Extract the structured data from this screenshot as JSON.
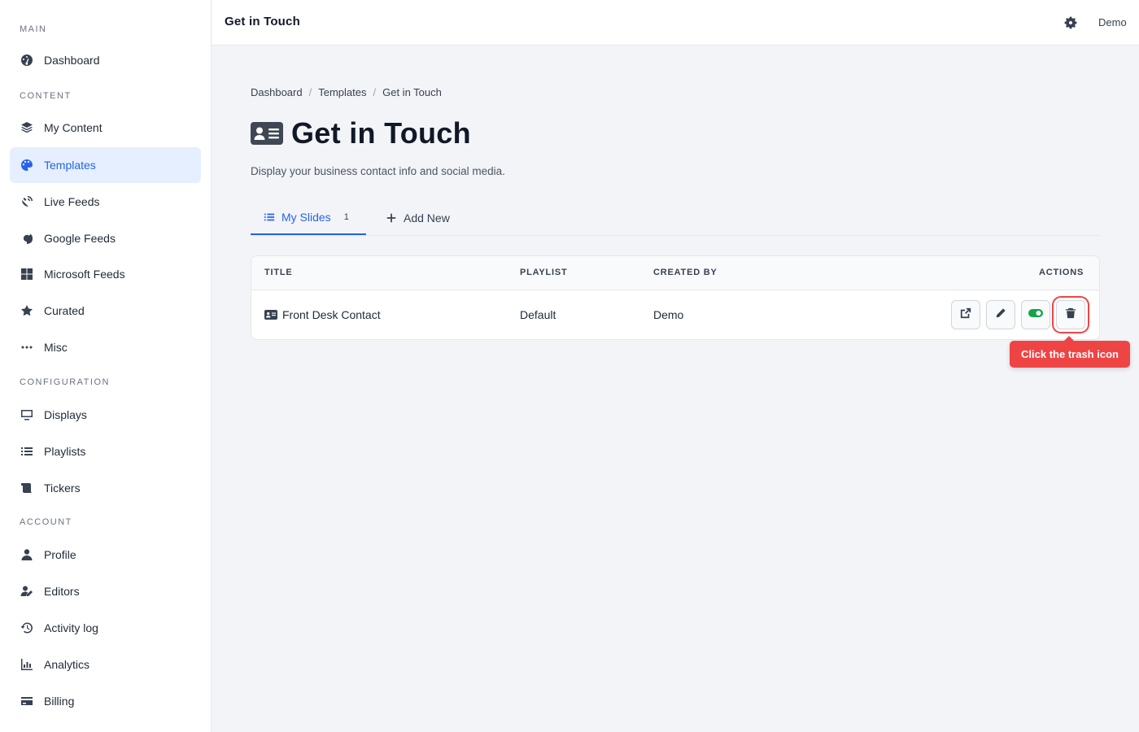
{
  "sidebar": {
    "sections": {
      "main": "MAIN",
      "content": "CONTENT",
      "configuration": "CONFIGURATION",
      "account": "ACCOUNT"
    },
    "items": {
      "dashboard": "Dashboard",
      "my_content": "My Content",
      "templates": "Templates",
      "live_feeds": "Live Feeds",
      "google_feeds": "Google Feeds",
      "microsoft_feeds": "Microsoft Feeds",
      "curated": "Curated",
      "misc": "Misc",
      "displays": "Displays",
      "playlists": "Playlists",
      "tickers": "Tickers",
      "profile": "Profile",
      "editors": "Editors",
      "activity_log": "Activity log",
      "analytics": "Analytics",
      "billing": "Billing"
    },
    "active_item": "templates"
  },
  "topbar": {
    "title": "Get in Touch",
    "user": "Demo"
  },
  "breadcrumb": {
    "items": [
      "Dashboard",
      "Templates",
      "Get in Touch"
    ],
    "separator": "/"
  },
  "page": {
    "title": "Get in Touch",
    "subtitle": "Display your business contact info and social media."
  },
  "tabs": {
    "my_slides": "My Slides",
    "my_slides_count": "1",
    "add_new": "Add New"
  },
  "table": {
    "headers": {
      "title": "TITLE",
      "playlist": "PLAYLIST",
      "created_by": "CREATED BY",
      "actions": "ACTIONS"
    },
    "rows": [
      {
        "title": "Front Desk Contact",
        "playlist": "Default",
        "created_by": "Demo"
      }
    ]
  },
  "tooltip": {
    "text": "Click the trash icon"
  },
  "colors": {
    "accent": "#2563eb",
    "active_bg": "#e6efff",
    "toggle_green": "#16a34a",
    "highlight_red": "#ef4444"
  }
}
